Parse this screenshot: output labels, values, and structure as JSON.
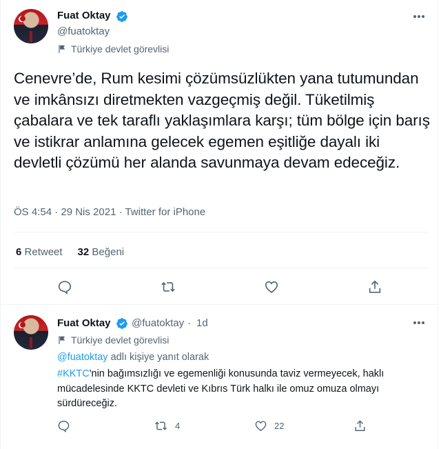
{
  "main_tweet": {
    "author_name": "Fuat Oktay",
    "author_handle": "@fuatoktay",
    "account_label": "Türkiye devlet görevlisi",
    "text": "Cenevre’de, Rum kesimi çözümsüzlükten yana tutumundan ve imkânsızı diretmekten vazgeçmiş değil. Tüketilmiş çabalara ve tek taraflı yaklaşımlara karşı; tüm bölge için barış ve istikrar anlamına gelecek egemen eşitliğe dayalı iki devletli çözümü her alanda savunmaya devam edeceğiz.",
    "meta": "ÖS 4:54 · 29 Nis 2021 · Twitter for iPhone",
    "retweet_count": "6",
    "retweet_label": "Retweet",
    "like_count": "32",
    "like_label": "Beğeni"
  },
  "reply_tweet": {
    "author_name": "Fuat Oktay",
    "author_handle": "@fuatoktay",
    "separator": "·",
    "time": "1d",
    "account_label": "Türkiye devlet görevlisi",
    "replying_to_mention": "@fuatoktay",
    "replying_to_suffix": " adlı kişiye yanıt olarak",
    "hashtag": "#KKTC",
    "body": "'nin bağımsızlığı ve egemenliği konusunda taviz vermeyecek, haklı mücadelesinde KKTC devleti ve Kıbrıs Türk halkı ile omuz omuza olmayı sürdüreceğiz.",
    "retweet_count": "4",
    "like_count": "22"
  },
  "icons": [
    "verified-badge-icon",
    "government-flag-icon",
    "more-options-icon",
    "reply-icon",
    "retweet-icon",
    "like-icon",
    "share-icon"
  ],
  "colors": {
    "accent": "#1d9bf0",
    "text": "#0f1419",
    "muted": "#536471",
    "divider": "#eff3f4"
  }
}
